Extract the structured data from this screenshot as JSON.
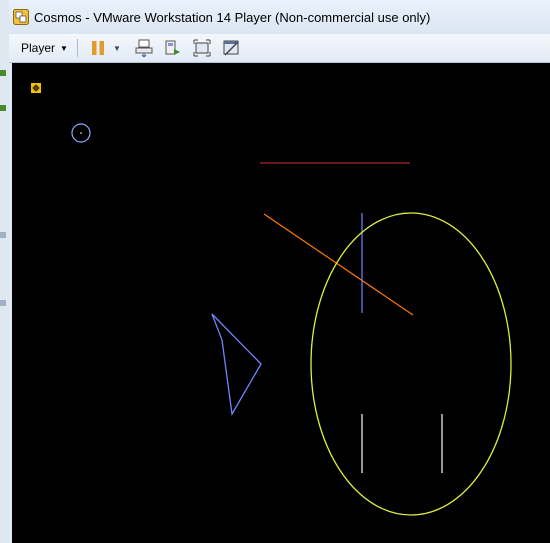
{
  "window": {
    "title": "Cosmos - VMware Workstation 14 Player (Non-commercial use only)"
  },
  "toolbar": {
    "player_menu_label": "Player",
    "icons": [
      "pause-icon",
      "send-ctrl-alt-del-icon",
      "removable-devices-icon",
      "full-screen-icon",
      "unity-icon"
    ]
  },
  "colors": {
    "vm_background": "#000000",
    "circle": "#8fa8ff",
    "horizontal_line": "#d0322a",
    "diagonal_line": "#ff7a00",
    "vertical_line": "#6e86ff",
    "ellipse": "#e2ef3a",
    "triangle": "#6e86ff",
    "legs": "#ffffff"
  }
}
